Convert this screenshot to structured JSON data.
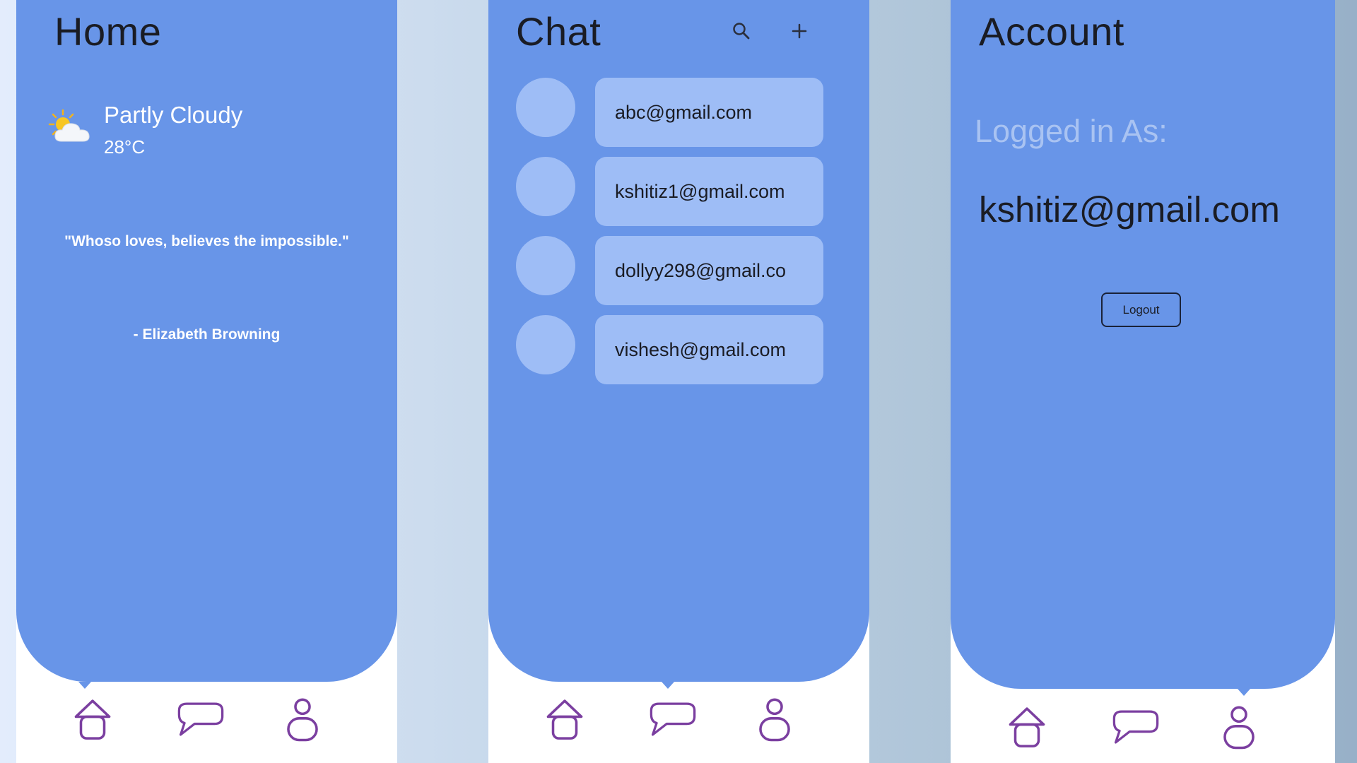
{
  "home": {
    "title": "Home",
    "weather": {
      "condition": "Partly Cloudy",
      "temperature": "28°C",
      "icon": "partly-cloudy-icon"
    },
    "quote": {
      "text": "\"Whoso loves, believes the impossible.\"",
      "author": "- Elizabeth Browning"
    }
  },
  "chat": {
    "title": "Chat",
    "actions": {
      "search_icon": "search-icon",
      "add_icon": "plus-icon"
    },
    "contacts": [
      {
        "email": "abc@gmail.com"
      },
      {
        "email": "kshitiz1@gmail.com"
      },
      {
        "email": "dollyy298@gmail.co"
      },
      {
        "email": "vishesh@gmail.com"
      }
    ]
  },
  "account": {
    "title": "Account",
    "logged_in_label": "Logged in As:",
    "email": "kshitiz@gmail.com",
    "logout_label": "Logout"
  },
  "nav": {
    "items": [
      {
        "name": "home",
        "icon": "home-icon"
      },
      {
        "name": "chat",
        "icon": "chat-bubble-icon"
      },
      {
        "name": "account",
        "icon": "user-icon"
      }
    ]
  },
  "colors": {
    "panel": "#6895e8",
    "tile": "#9ebdf6",
    "nav_icon": "#7b3fa0",
    "title_text": "#1a1c24",
    "muted_label": "#a9c3f2"
  }
}
